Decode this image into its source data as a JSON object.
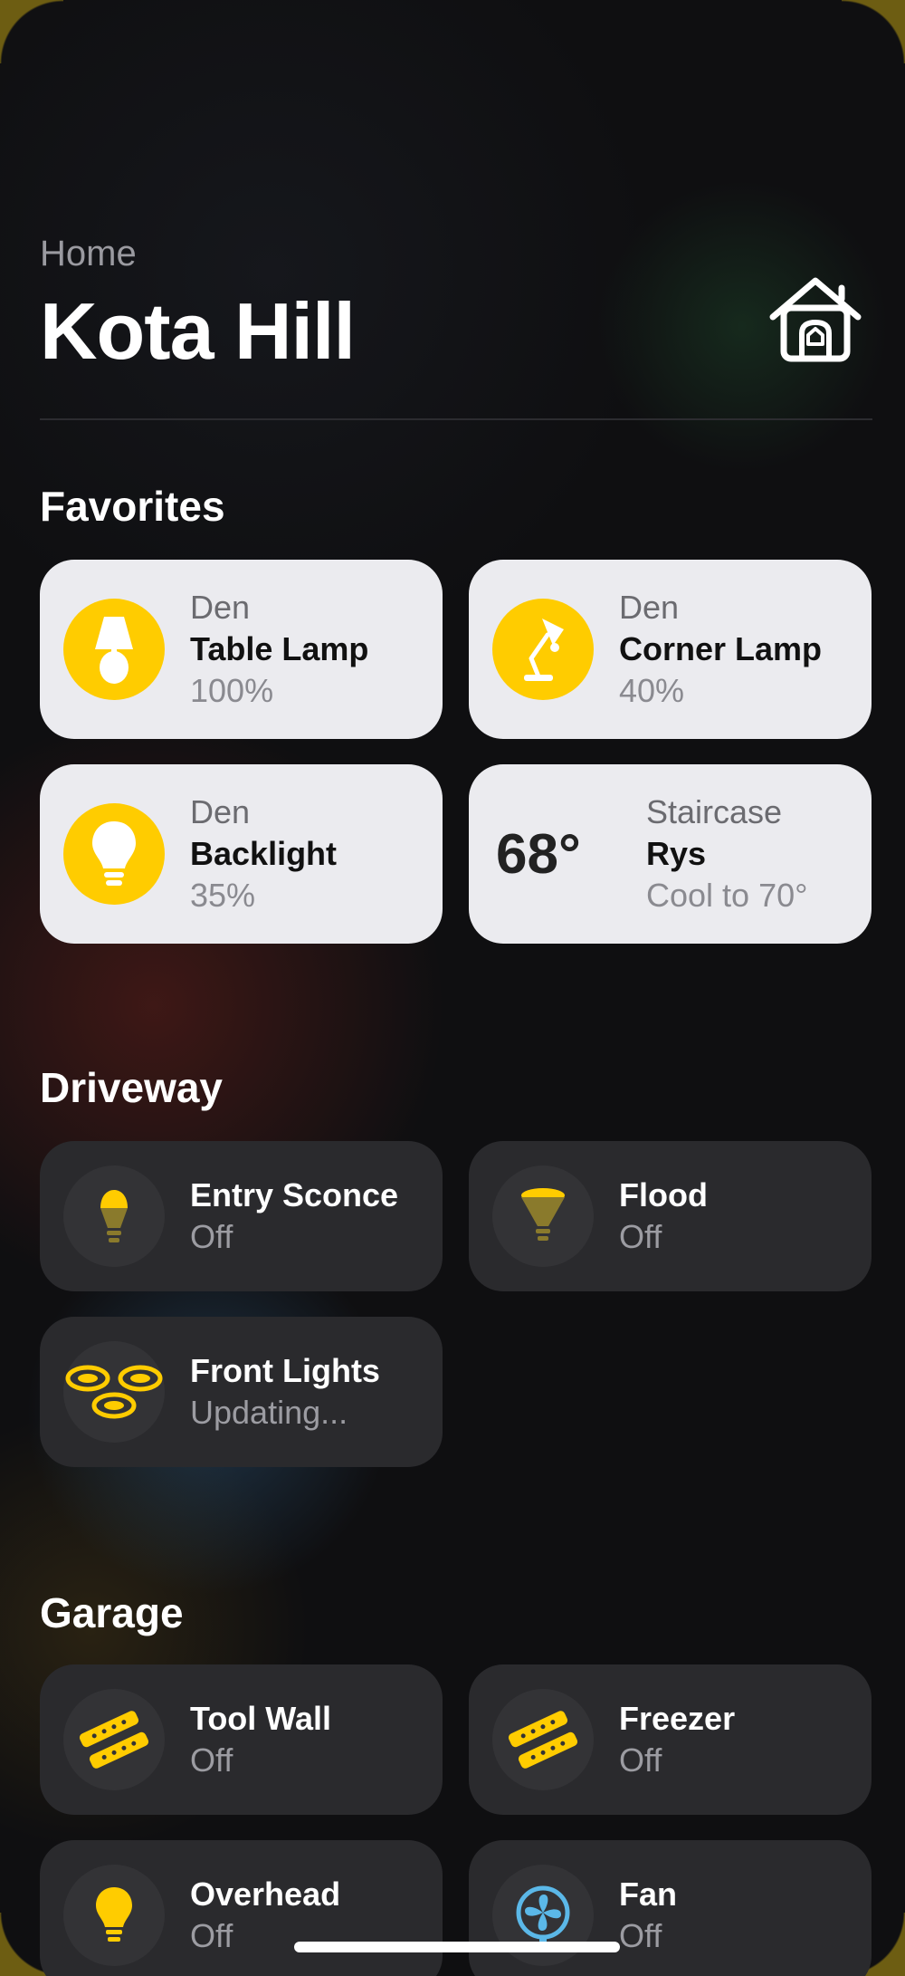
{
  "header": {
    "breadcrumb": "Home",
    "title": "Kota Hill",
    "home_icon": "house-icon"
  },
  "sections": {
    "favorites": {
      "title": "Favorites",
      "tiles": [
        {
          "room": "Den",
          "name": "Table Lamp",
          "status": "100%",
          "icon": "table-lamp-icon"
        },
        {
          "room": "Den",
          "name": "Corner Lamp",
          "status": "40%",
          "icon": "desk-lamp-icon"
        },
        {
          "room": "Den",
          "name": "Backlight",
          "status": "35%",
          "icon": "bulb-icon"
        },
        {
          "room": "Staircase",
          "name": "Rys",
          "status": "Cool to 70°",
          "temp": "68°"
        }
      ]
    },
    "driveway": {
      "title": "Driveway",
      "tiles": [
        {
          "name": "Entry Sconce",
          "status": "Off",
          "icon": "sconce-bulb-icon"
        },
        {
          "name": "Flood",
          "status": "Off",
          "icon": "flood-bulb-icon"
        },
        {
          "name": "Front Lights",
          "status": "Updating...",
          "icon": "recessed-lights-icon"
        }
      ]
    },
    "garage": {
      "title": "Garage",
      "tiles": [
        {
          "name": "Tool Wall",
          "status": "Off",
          "icon": "power-strip-icon"
        },
        {
          "name": "Freezer",
          "status": "Off",
          "icon": "power-strip-icon"
        },
        {
          "name": "Overhead",
          "status": "Off",
          "icon": "bulb-icon"
        },
        {
          "name": "Fan",
          "status": "Off",
          "icon": "fan-icon"
        }
      ]
    }
  },
  "colors": {
    "accent": "#ffcc00",
    "light_tile": "#ebebef",
    "dark_tile": "#2a2a2d",
    "background": "#101012"
  }
}
